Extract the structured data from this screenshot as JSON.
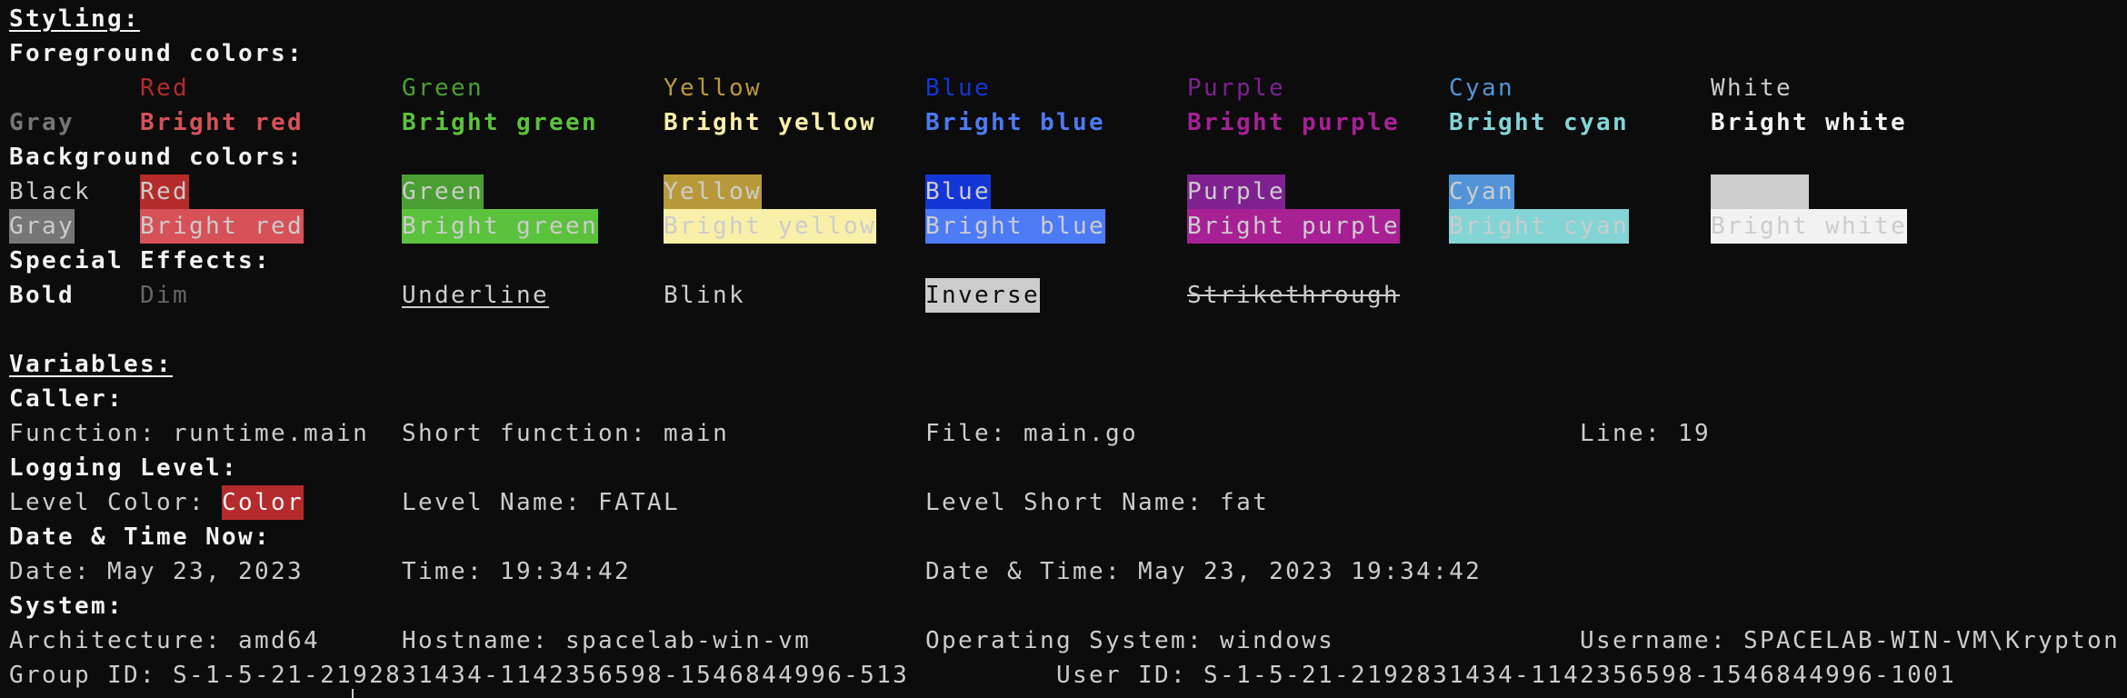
{
  "styling": {
    "title": "Styling:",
    "foreground_title": "Foreground colors:",
    "foreground_normal": [
      {
        "label": "Red",
        "color": "#b52a2a"
      },
      {
        "label": "Green",
        "color": "#4a9f32"
      },
      {
        "label": "Yellow",
        "color": "#b8993a"
      },
      {
        "label": "Blue",
        "color": "#1536d6"
      },
      {
        "label": "Purple",
        "color": "#7e2191"
      },
      {
        "label": "Cyan",
        "color": "#5195d8"
      },
      {
        "label": "White",
        "color": "#cccccc"
      }
    ],
    "foreground_bright": [
      {
        "label": "Gray",
        "color": "#767676"
      },
      {
        "label": "Bright red",
        "color": "#d65158"
      },
      {
        "label": "Bright green",
        "color": "#5bc23d"
      },
      {
        "label": "Bright yellow",
        "color": "#f8f0a8"
      },
      {
        "label": "Bright blue",
        "color": "#4d7af5"
      },
      {
        "label": "Bright purple",
        "color": "#a72195"
      },
      {
        "label": "Bright cyan",
        "color": "#83d5d5"
      },
      {
        "label": "Bright white",
        "color": "#f2f2f2"
      }
    ],
    "background_title": "Background colors:",
    "background_normal": [
      {
        "label": "Black",
        "color": "#0c0c0c"
      },
      {
        "label": "Red",
        "color": "#b52a2a"
      },
      {
        "label": "Green",
        "color": "#4a9f32"
      },
      {
        "label": "Yellow",
        "color": "#b8993a"
      },
      {
        "label": "Blue",
        "color": "#1536d6"
      },
      {
        "label": "Purple",
        "color": "#7e2191"
      },
      {
        "label": "Cyan",
        "color": "#5195d8"
      },
      {
        "label": "      ",
        "color": "#cccccc"
      }
    ],
    "background_bright": [
      {
        "label": "Gray",
        "color": "#767676"
      },
      {
        "label": "Bright red",
        "color": "#d65158"
      },
      {
        "label": "Bright green",
        "color": "#5bc23d"
      },
      {
        "label": "Bright yellow",
        "color": "#f8f0a8"
      },
      {
        "label": "Bright blue",
        "color": "#4d7af5"
      },
      {
        "label": "Bright purple",
        "color": "#a72195"
      },
      {
        "label": "Bright cyan",
        "color": "#83d5d5"
      },
      {
        "label": "Bright white",
        "color": "#f2f2f2"
      }
    ],
    "effects_title": "Special Effects:",
    "effects": {
      "bold": "Bold",
      "dim": "Dim",
      "underline": "Underline",
      "blink": "Blink",
      "inverse": "Inverse",
      "strikethrough": "Strikethrough"
    }
  },
  "variables": {
    "title": "Variables:",
    "caller_title": "Caller:",
    "function": "Function: runtime.main",
    "short_function": "Short function: main",
    "file": "File: main.go",
    "line": "Line: 19",
    "logging_title": "Logging Level:",
    "level_color_label": "Level Color: ",
    "level_color_value": "Color",
    "level_color": "#b52a2a",
    "level_name": "Level Name: FATAL",
    "level_short_name": "Level Short Name: fat",
    "datetime_title": "Date & Time Now:",
    "date": "Date: May 23, 2023",
    "time": "Time: 19:34:42",
    "date_time": "Date & Time: May 23, 2023 19:34:42",
    "system_title": "System:",
    "architecture": "Architecture: amd64",
    "hostname": "Hostname: spacelab-win-vm",
    "os": "Operating System: windows",
    "username": "Username: SPACELAB-WIN-VM\\Krypton",
    "group_id": "Group ID: S-1-5-21-2192831434-1142356598-1546844996-513",
    "user_id": "User ID: S-1-5-21-2192831434-1142356598-1546844996-1001"
  }
}
